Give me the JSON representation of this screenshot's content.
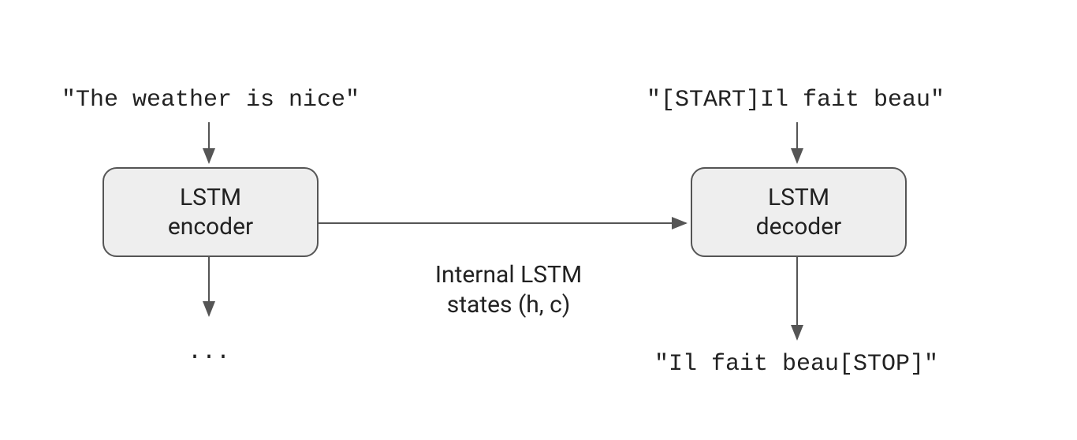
{
  "encoder": {
    "input": "\"The weather is nice\"",
    "box_line1": "LSTM",
    "box_line2": "encoder",
    "output": "..."
  },
  "decoder": {
    "input": "\"[START]Il fait beau\"",
    "box_line1": "LSTM",
    "box_line2": "decoder",
    "output": "\"Il fait beau[STOP]\""
  },
  "edge_label_line1": "Internal LSTM",
  "edge_label_line2": "states (h, c)",
  "colors": {
    "node_fill": "#eeeeee",
    "stroke": "#555555",
    "text": "#222222"
  }
}
